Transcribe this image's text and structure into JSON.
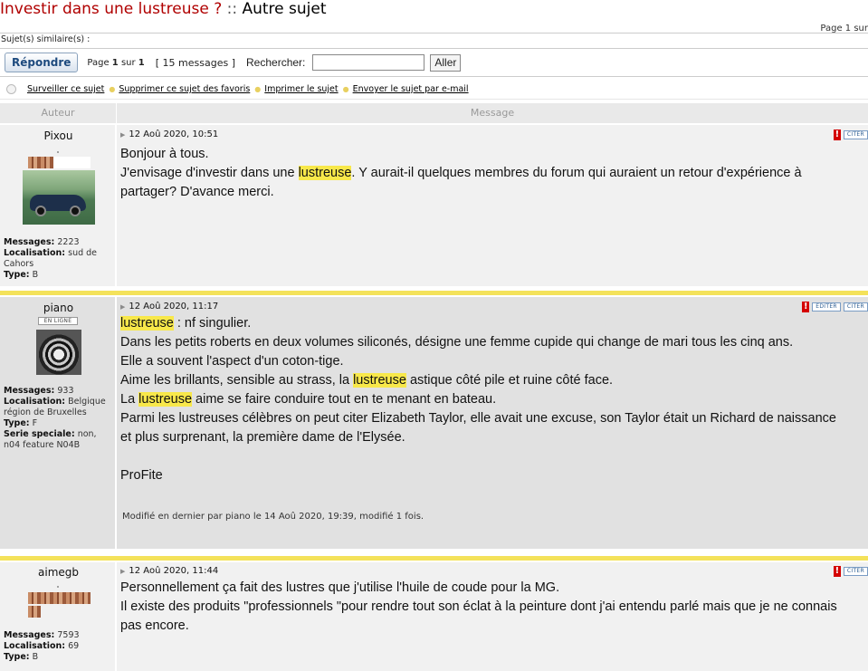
{
  "header": {
    "title": "Investir dans une lustreuse ?",
    "separator": " :: ",
    "category": "Autre sujet",
    "page_indicator": "Page 1 sur"
  },
  "similar_label": "Sujet(s) similaire(s) :",
  "toolbar": {
    "reply_label": "Répondre",
    "page_prefix": "Page ",
    "page_current": "1",
    "page_of": " sur ",
    "page_total": "1",
    "message_count": "[ 15 messages ]",
    "search_label": "Rechercher:",
    "search_value": "",
    "go_label": "Aller"
  },
  "actions": [
    "Surveiller ce sujet",
    "Supprimer ce sujet des favoris",
    "Imprimer le sujet",
    "Envoyer le sujet par e-mail"
  ],
  "table_header": {
    "author": "Auteur",
    "message": "Message"
  },
  "icons": {
    "alert": "report-icon",
    "quote": "CITER",
    "edit": "EDITER"
  },
  "highlight_color": "#f8e84a",
  "posts": [
    {
      "author": "Pixou",
      "date": "12 Aoû 2020, 10:51",
      "stats": [
        {
          "label": "Messages:",
          "value": "2223"
        },
        {
          "label": "Localisation:",
          "value": "sud de Cahors"
        },
        {
          "label": "Type:",
          "value": "B"
        }
      ],
      "lines": [
        [
          "Bonjour à tous."
        ],
        [
          "J'envisage d'investir dans une ",
          "lustreuse",
          ". Y aurait-il quelques membres du forum qui auraient un retour d'expérience à"
        ],
        [
          "partager? D'avance merci."
        ]
      ]
    },
    {
      "author": "piano",
      "badge": "EN LIGNE",
      "date": "12 Aoû 2020, 11:17",
      "stats": [
        {
          "label": "Messages:",
          "value": "933"
        },
        {
          "label": "Localisation:",
          "value": "Belgique région de Bruxelles"
        },
        {
          "label": "Type:",
          "value": "F"
        },
        {
          "label": "Serie speciale:",
          "value": "non, n04 feature N04B"
        }
      ],
      "lines": [
        [
          "lustreuse",
          " : nf singulier."
        ],
        [
          "Dans les petits roberts en deux volumes siliconés, désigne une femme cupide qui change de mari tous les cinq ans."
        ],
        [
          "Elle a souvent l'aspect d'un coton-tige."
        ],
        [
          "Aime les brillants, sensible au strass, la ",
          "lustreuse",
          " astique côté pile et ruine côté face."
        ],
        [
          "La ",
          "lustreuse",
          " aime se faire conduire tout en te menant en bateau."
        ],
        [
          "Parmi les lustreuses célèbres on peut citer Elizabeth Taylor, elle avait une excuse, son Taylor était un Richard de naissance"
        ],
        [
          "et plus surprenant, la première dame de l'Elysée."
        ],
        [
          ""
        ],
        [
          "ProFite"
        ]
      ],
      "edited_prefix": "Modifié en dernier par ",
      "edited_by": "piano",
      "edited_suffix": " le 14 Aoû 2020, 19:39, modifié 1 fois."
    },
    {
      "author": "aimegb",
      "date": "12 Aoû 2020, 11:44",
      "stats": [
        {
          "label": "Messages:",
          "value": "7593"
        },
        {
          "label": "Localisation:",
          "value": "69"
        },
        {
          "label": "Type:",
          "value": "B"
        }
      ],
      "lines": [
        [
          "Personnellement ça fait des lustres que j'utilise l'huile de coude pour la MG."
        ],
        [
          "Il existe des produits \"professionnels \"pour rendre tout son éclat à la peinture dont j'ai entendu parlé mais que je ne connais"
        ],
        [
          "pas encore."
        ]
      ]
    }
  ]
}
